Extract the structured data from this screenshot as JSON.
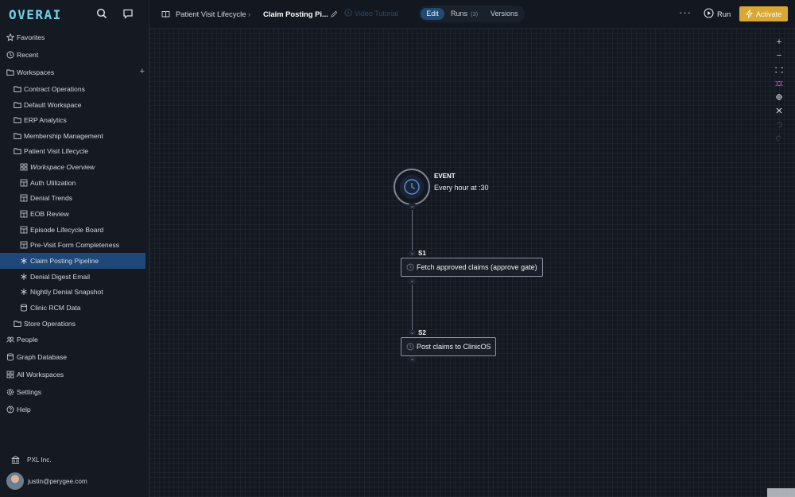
{
  "app": {
    "logo": "OVERAI"
  },
  "sidebar": {
    "items": [
      {
        "label": "Favorites",
        "icon": "star-icon"
      },
      {
        "label": "Recent",
        "icon": "clock-icon"
      },
      {
        "label": "Workspaces",
        "icon": "folder-icon"
      }
    ],
    "workspaces": [
      {
        "label": "Contract Operations"
      },
      {
        "label": "Default Workspace"
      },
      {
        "label": "ERP Analytics"
      },
      {
        "label": "Membership Management"
      },
      {
        "label": "Patient Visit Lifecycle"
      }
    ],
    "children": [
      {
        "label": "Workspace Overview",
        "icon": "grid-icon"
      },
      {
        "label": "Auth Utilization",
        "icon": "grid-icon"
      },
      {
        "label": "Denial Trends",
        "icon": "grid-icon"
      },
      {
        "label": "EOB Review",
        "icon": "grid-icon"
      },
      {
        "label": "Episode Lifecycle Board",
        "icon": "grid-icon"
      },
      {
        "label": "Pre-Visit Form Completeness",
        "icon": "grid-icon"
      },
      {
        "label": "Claim Posting Pipeline",
        "icon": "flow-icon"
      },
      {
        "label": "Denial Digest Email",
        "icon": "flow-icon"
      },
      {
        "label": "Nightly Denial Snapshot",
        "icon": "flow-icon"
      },
      {
        "label": "Clinic RCM Data",
        "icon": "database-icon"
      }
    ],
    "store": {
      "label": "Store Operations"
    },
    "bottom": [
      {
        "label": "People",
        "icon": "people-icon"
      },
      {
        "label": "Graph Database",
        "icon": "database-icon"
      },
      {
        "label": "All Workspaces",
        "icon": "grid-icon"
      },
      {
        "label": "Settings",
        "icon": "gear-icon"
      },
      {
        "label": "Help",
        "icon": "help-icon"
      }
    ],
    "org": "PXL Inc.",
    "user_email": "justin@perygee.com"
  },
  "header": {
    "breadcrumb_parent": "Patient Visit Lifecycle",
    "breadcrumb_current": "Claim Posting Pi...",
    "video_tutorial": "Video Tutorial",
    "tabs": {
      "edit": "Edit",
      "runs": "Runs",
      "runs_count": "(3)",
      "versions": "Versions"
    },
    "more": "···",
    "run": "Run",
    "activate": "Activate"
  },
  "canvas": {
    "event": {
      "title": "EVENT",
      "description": "Every hour at :30"
    },
    "steps": [
      {
        "id": "S1",
        "label": "Fetch approved claims (approve gate)"
      },
      {
        "id": "S2",
        "label": "Post claims to ClinicOS"
      }
    ],
    "toolbar": [
      "+",
      "−"
    ]
  },
  "colors": {
    "accent": "#1f4778",
    "activate": "#d9a733",
    "logo": "#6fd3ea"
  }
}
